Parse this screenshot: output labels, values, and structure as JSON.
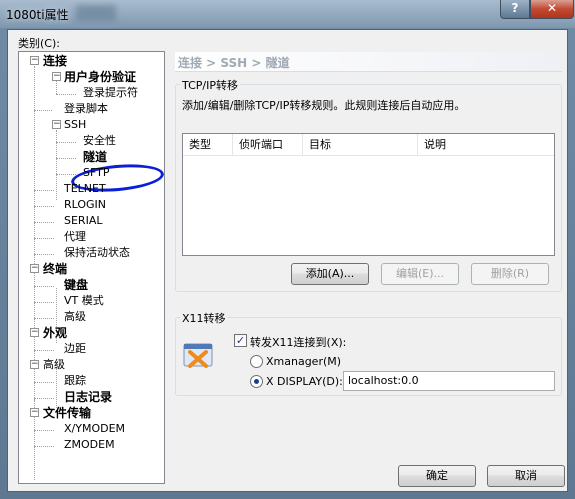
{
  "window": {
    "title": "1080ti属性",
    "help_label": "?",
    "close_label": "✕"
  },
  "category_label": "类别(C):",
  "tree": {
    "items": [
      {
        "label": "连接",
        "bold": true
      },
      {
        "label": "用户身份验证",
        "bold": true
      },
      {
        "label": "登录提示符",
        "bold": false
      },
      {
        "label": "登录脚本",
        "bold": false
      },
      {
        "label": "SSH",
        "bold": false
      },
      {
        "label": "安全性",
        "bold": false
      },
      {
        "label": "隧道",
        "bold": true
      },
      {
        "label": "SFTP",
        "bold": false
      },
      {
        "label": "TELNET",
        "bold": false
      },
      {
        "label": "RLOGIN",
        "bold": false
      },
      {
        "label": "SERIAL",
        "bold": false
      },
      {
        "label": "代理",
        "bold": false
      },
      {
        "label": "保持活动状态",
        "bold": false
      },
      {
        "label": "终端",
        "bold": true
      },
      {
        "label": "键盘",
        "bold": true
      },
      {
        "label": "VT 模式",
        "bold": false
      },
      {
        "label": "高级",
        "bold": false
      },
      {
        "label": "外观",
        "bold": true
      },
      {
        "label": "边距",
        "bold": false
      },
      {
        "label": "高级",
        "bold": false
      },
      {
        "label": "跟踪",
        "bold": false
      },
      {
        "label": "日志记录",
        "bold": true
      },
      {
        "label": "文件传输",
        "bold": true
      },
      {
        "label": "X/YMODEM",
        "bold": false
      },
      {
        "label": "ZMODEM",
        "bold": false
      }
    ]
  },
  "breadcrumb": "连接 > SSH > 隧道",
  "tcpip": {
    "group_title": "TCP/IP转移",
    "description": "添加/编辑/删除TCP/IP转移规则。此规则连接后自动应用。",
    "columns": [
      "类型",
      "侦听端口",
      "目标",
      "说明"
    ],
    "add_label": "添加(A)...",
    "edit_label": "编辑(E)...",
    "delete_label": "删除(R)"
  },
  "x11": {
    "group_title": "X11转移",
    "forward_label": "转发X11连接到(X):",
    "forward_checked": true,
    "xmanager_label": "Xmanager(M)",
    "xdisplay_label": "X DISPLAY(D):",
    "xdisplay_value": "localhost:0.0",
    "selected": "xdisplay"
  },
  "buttons": {
    "ok_label": "确定",
    "cancel_label": "取消"
  }
}
